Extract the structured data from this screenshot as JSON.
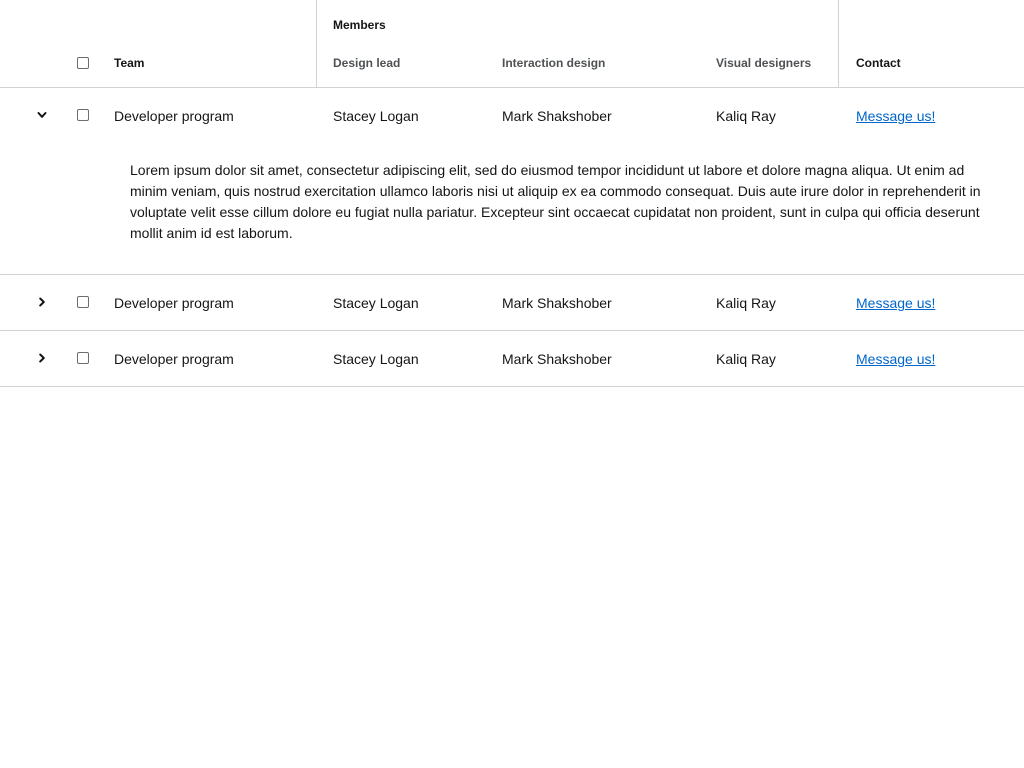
{
  "header": {
    "group_members": "Members",
    "col_team": "Team",
    "col_design_lead": "Design lead",
    "col_interaction": "Interaction design",
    "col_visual": "Visual designers",
    "col_contact": "Contact"
  },
  "rows": [
    {
      "team": "Developer program",
      "design_lead": "Stacey Logan",
      "interaction": "Mark Shakshober",
      "visual": "Kaliq Ray",
      "contact": "Message us!",
      "expanded": true,
      "detail": "Lorem ipsum dolor sit amet, consectetur adipiscing elit, sed do eiusmod tempor incididunt ut labore et dolore magna aliqua. Ut enim ad minim veniam, quis nostrud exercitation ullamco laboris nisi ut aliquip ex ea commodo consequat. Duis aute irure dolor in reprehenderit in voluptate velit esse cillum dolore eu fugiat nulla pariatur. Excepteur sint occaecat cupidatat non proident, sunt in culpa qui officia deserunt mollit anim id est laborum."
    },
    {
      "team": "Developer program",
      "design_lead": "Stacey Logan",
      "interaction": "Mark Shakshober",
      "visual": "Kaliq Ray",
      "contact": "Message us!",
      "expanded": false
    },
    {
      "team": "Developer program",
      "design_lead": "Stacey Logan",
      "interaction": "Mark Shakshober",
      "visual": "Kaliq Ray",
      "contact": "Message us!",
      "expanded": false
    }
  ],
  "colors": {
    "link": "#0066cc",
    "border": "#d2d2d2",
    "text": "#151515",
    "subheader": "#4f5255"
  },
  "icons": {
    "expanded_toggle": "chevron-down-icon",
    "collapsed_toggle": "chevron-right-icon"
  }
}
